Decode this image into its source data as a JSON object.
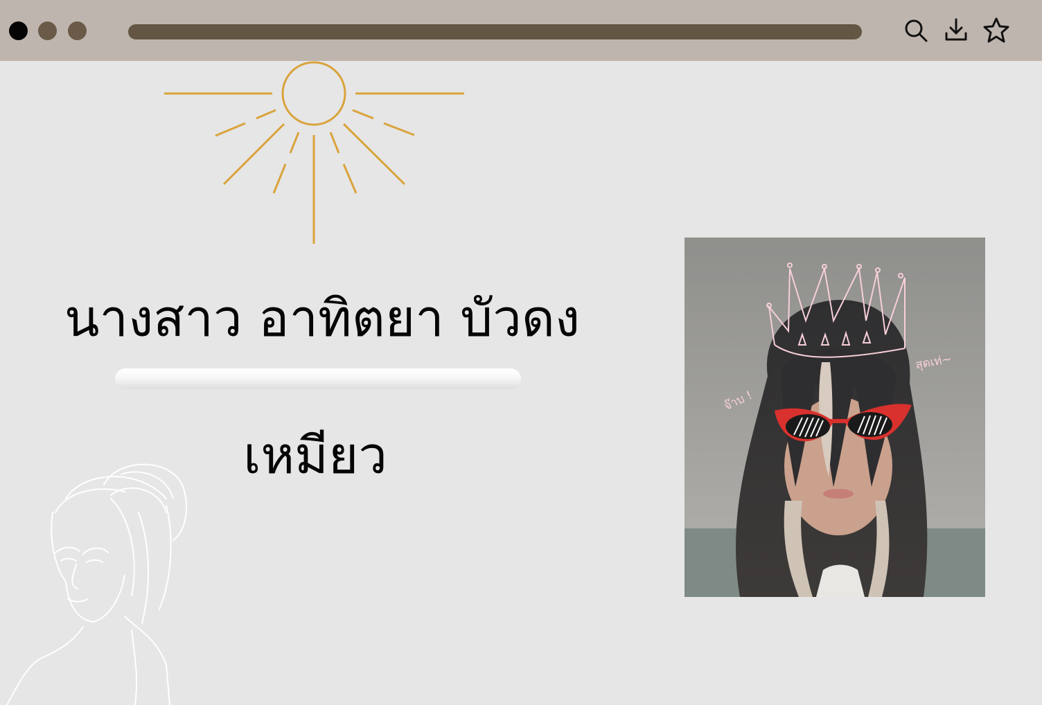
{
  "browser": {
    "window_controls": [
      "close",
      "minimize",
      "maximize"
    ],
    "toolbar_icons": [
      "search-icon",
      "download-icon",
      "star-icon"
    ],
    "colors": {
      "titlebar": "#beb5ae",
      "address_bar": "#635744",
      "dot_dark": "#050505",
      "dot_brown": "#6a5a47"
    }
  },
  "profile": {
    "full_name": "นางสาว อาทิตยา บัวดง",
    "nickname": "เหมียว",
    "accent_color": "#d9a33c"
  },
  "photo": {
    "doodle_text_left": "จ๊าบ !",
    "doodle_text_right": "สุดเท่~"
  }
}
